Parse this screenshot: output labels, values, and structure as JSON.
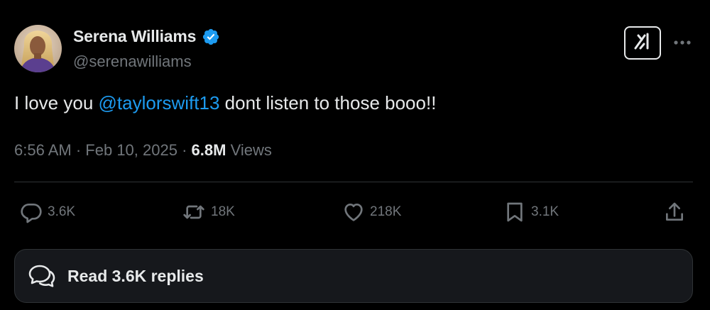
{
  "author": {
    "display_name": "Serena Williams",
    "handle": "@serenawilliams",
    "verified": true,
    "avatar_icon": "profile-photo",
    "verified_icon": "verified-badge-icon",
    "verified_color": "#1d9bf0"
  },
  "header_actions": {
    "grok_icon": "grok-icon",
    "more_icon": "more-dots-icon"
  },
  "tweet": {
    "text_before": "I love you ",
    "mention": "@taylorswift13",
    "text_after": " dont listen to those booo!!"
  },
  "meta": {
    "time": "6:56 AM",
    "separator": "·",
    "date": "Feb 10, 2025",
    "views_count": "6.8M",
    "views_label": "Views"
  },
  "actions": {
    "reply": {
      "icon": "reply-icon",
      "count": "3.6K"
    },
    "retweet": {
      "icon": "retweet-icon",
      "count": "18K"
    },
    "like": {
      "icon": "heart-icon",
      "count": "218K"
    },
    "bookmark": {
      "icon": "bookmark-icon",
      "count": "3.1K"
    },
    "share": {
      "icon": "share-icon"
    }
  },
  "replies_button": {
    "icon": "conversation-icon",
    "label": "Read 3.6K replies"
  },
  "colors": {
    "background": "#000000",
    "text_primary": "#e7e9ea",
    "text_secondary": "#71767b",
    "accent": "#1d9bf0",
    "divider": "#2f3336",
    "card": "#16181c"
  }
}
